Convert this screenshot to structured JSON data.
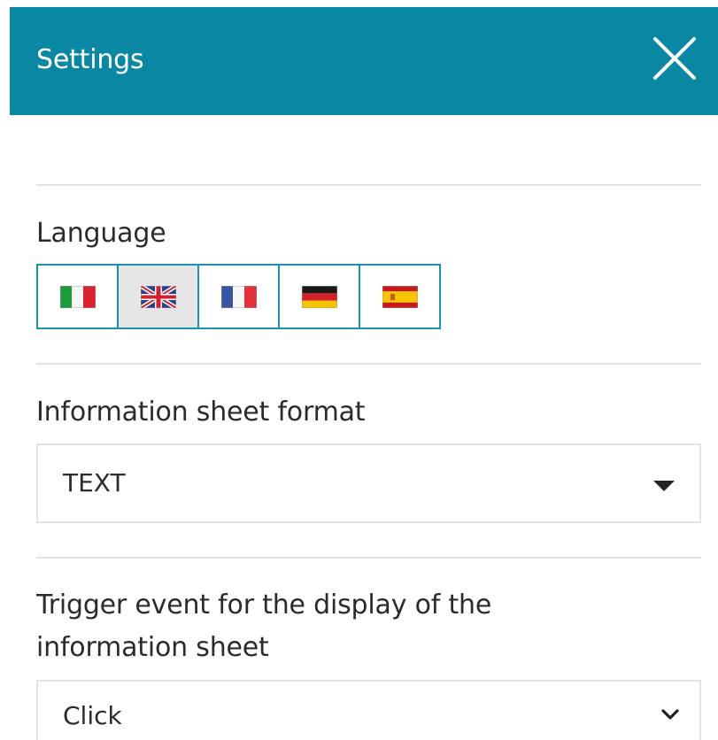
{
  "header": {
    "title": "Settings",
    "close_icon": "close-icon",
    "background_color": "#0a87a3"
  },
  "language": {
    "label": "Language",
    "selected": "english",
    "options": [
      {
        "id": "italian",
        "icon": "flag-italy-icon"
      },
      {
        "id": "english",
        "icon": "flag-uk-icon"
      },
      {
        "id": "french",
        "icon": "flag-france-icon"
      },
      {
        "id": "german",
        "icon": "flag-germany-icon"
      },
      {
        "id": "spanish",
        "icon": "flag-spain-icon"
      }
    ]
  },
  "info_format": {
    "label": "Information sheet format",
    "value": "TEXT",
    "icon": "caret-down-icon"
  },
  "trigger": {
    "label_line1": "Trigger event for the display of the",
    "label_line2": "information sheet",
    "value": "Click",
    "icon": "chevron-down-icon"
  }
}
